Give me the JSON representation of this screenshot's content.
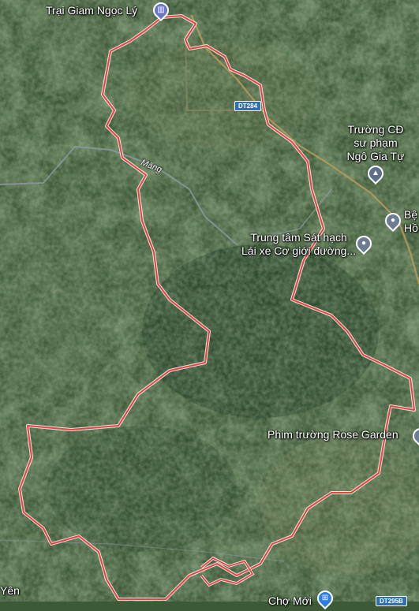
{
  "map": {
    "type": "satellite",
    "boundary_color": "#e8423f",
    "poi_colors": {
      "prison": "#6a76c9",
      "school": "#5d6f8a",
      "generic": "#6b7c93",
      "market": "#2b7de9"
    }
  },
  "places": {
    "trai_giam": "Trại Giam Ngọc Lý",
    "truong_cd_1": "Trường CĐ",
    "truong_cd_2": "sư phạm",
    "truong_cd_3": "Ngô Gia Tự",
    "benh_vien_1": "Bệ",
    "benh_vien_2": "Hồ",
    "trung_tam_1": "Trung tâm Sát hạch",
    "trung_tam_2": "Lái xe Cơ giới đường...",
    "phim_truong": "Phim trường Rose Garden",
    "cho_moi": "Chợ Mới",
    "yen": "Yên"
  },
  "roads": {
    "dt284": "DT284",
    "dt295b": "DT295B",
    "mang": "Măng"
  },
  "icons": {
    "prison": "building-icon",
    "school": "graduation-cap-icon",
    "hospital": "pin-icon",
    "center": "pin-icon",
    "studio": "pin-icon",
    "market": "cart-icon"
  }
}
